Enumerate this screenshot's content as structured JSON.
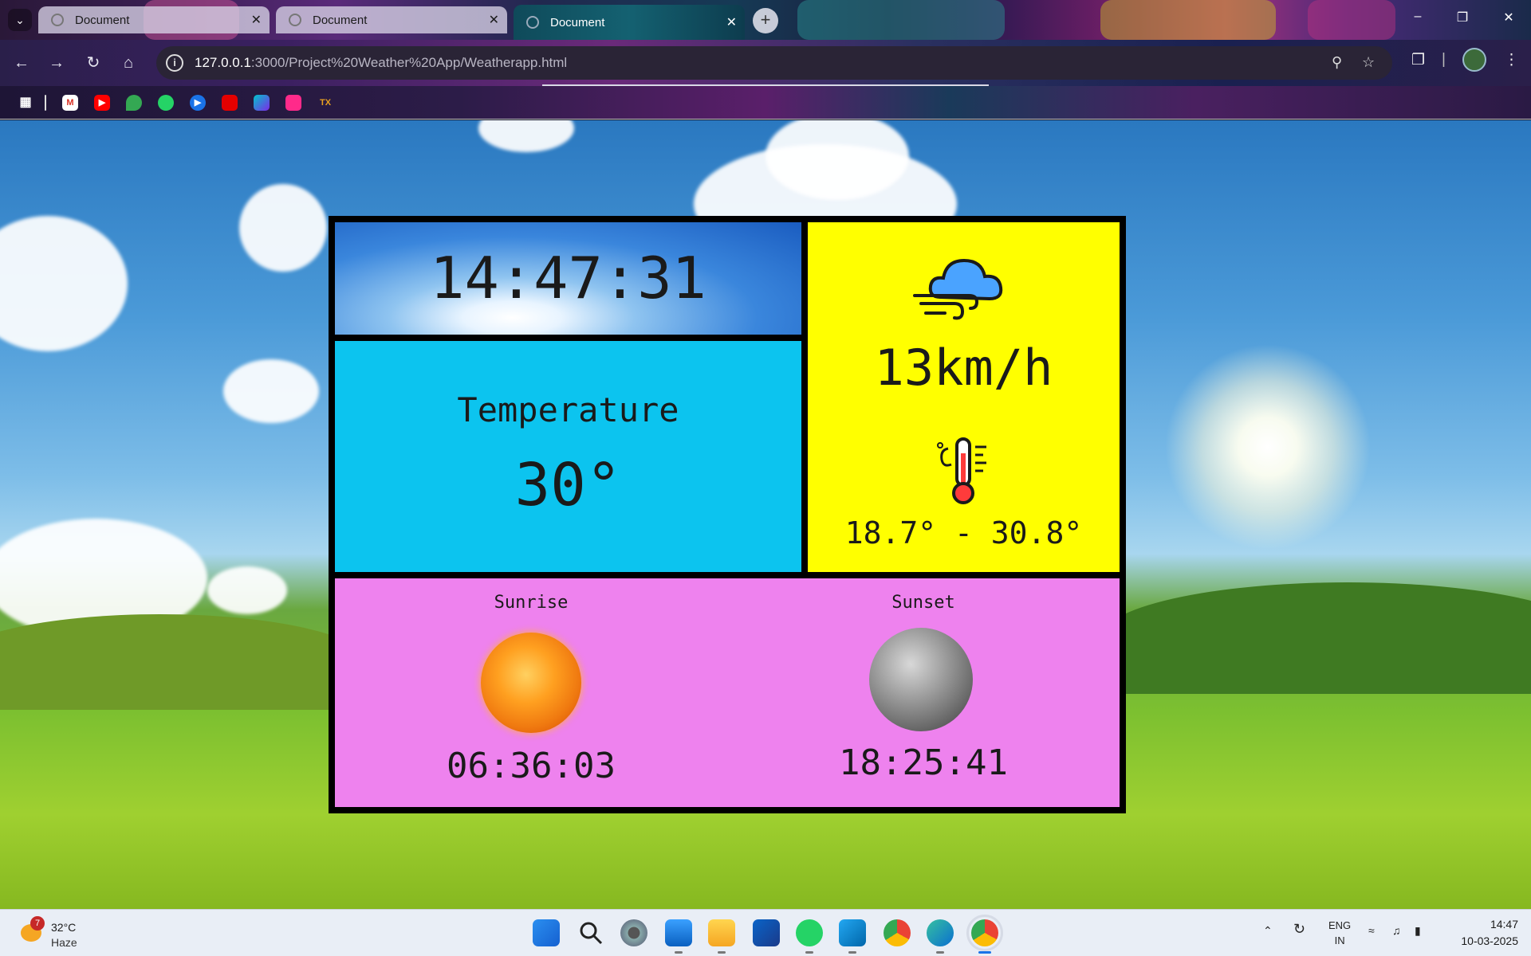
{
  "browser": {
    "tabs": [
      {
        "title": "Document",
        "active": false
      },
      {
        "title": "Document",
        "active": false
      },
      {
        "title": "Document",
        "active": true
      }
    ],
    "url_host": "127.0.0.1",
    "url_path": ":3000/Project%20Weather%20App/Weatherapp.html",
    "bookmarks": [
      "apps-icon",
      "gmail-icon",
      "youtube-icon",
      "maps-icon",
      "whatsapp-icon",
      "play-icon",
      "airtel-icon",
      "canva-icon",
      "store-icon",
      "tx-icon"
    ],
    "bookmark_tx_label": "TX"
  },
  "weather": {
    "clock": "14:47:31",
    "temperature_label": "Temperature",
    "temperature_value": "30°",
    "wind_speed": "13km/h",
    "temp_range": "18.7° -  30.8°",
    "sunrise_label": "Sunrise",
    "sunrise_time": "06:36:03",
    "sunset_label": "Sunset",
    "sunset_time": "18:25:41"
  },
  "colors": {
    "temp_panel": "#0cc4ef",
    "wind_panel": "#ffff00",
    "sun_panel": "#ee82ee"
  },
  "taskbar": {
    "weather_temp": "32°C",
    "weather_condition": "Haze",
    "weather_badge": "7",
    "apps": [
      "windows-start-icon",
      "search-icon",
      "settings-icon",
      "photos-icon",
      "file-explorer-icon",
      "microsoft-store-icon",
      "whatsapp-icon",
      "vscode-icon",
      "chrome-icon",
      "edge-icon",
      "chrome-profile-icon"
    ],
    "language_top": "ENG",
    "language_bottom": "IN",
    "time": "14:47",
    "date": "10-03-2025"
  }
}
